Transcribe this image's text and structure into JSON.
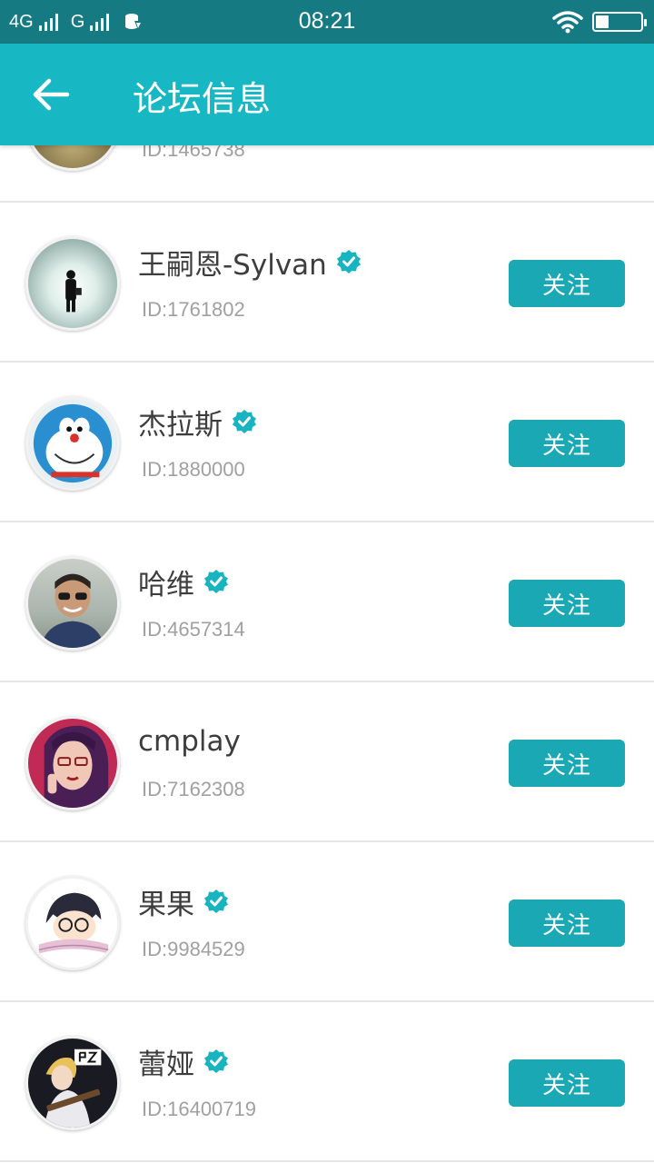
{
  "status_bar": {
    "network_1": "4G",
    "network_2": "G",
    "time": "08:21"
  },
  "header": {
    "title": "论坛信息"
  },
  "colors": {
    "header": "#17b7c4",
    "status_bar": "#157a82",
    "button": "#1aa8b5",
    "verified": "#18b4c2"
  },
  "users": [
    {
      "name": "",
      "id": "ID:1465738",
      "verified": false,
      "follow_label": ""
    },
    {
      "name": "王嗣恩-Sylvan",
      "id": "ID:1761802",
      "verified": true,
      "follow_label": "关注"
    },
    {
      "name": "杰拉斯",
      "id": "ID:1880000",
      "verified": true,
      "follow_label": "关注"
    },
    {
      "name": "哈维",
      "id": "ID:4657314",
      "verified": true,
      "follow_label": "关注"
    },
    {
      "name": "cmplay",
      "id": "ID:7162308",
      "verified": false,
      "follow_label": "关注"
    },
    {
      "name": "果果",
      "id": "ID:9984529",
      "verified": true,
      "follow_label": "关注"
    },
    {
      "name": "蕾娅",
      "id": "ID:16400719",
      "verified": true,
      "follow_label": "关注"
    }
  ]
}
